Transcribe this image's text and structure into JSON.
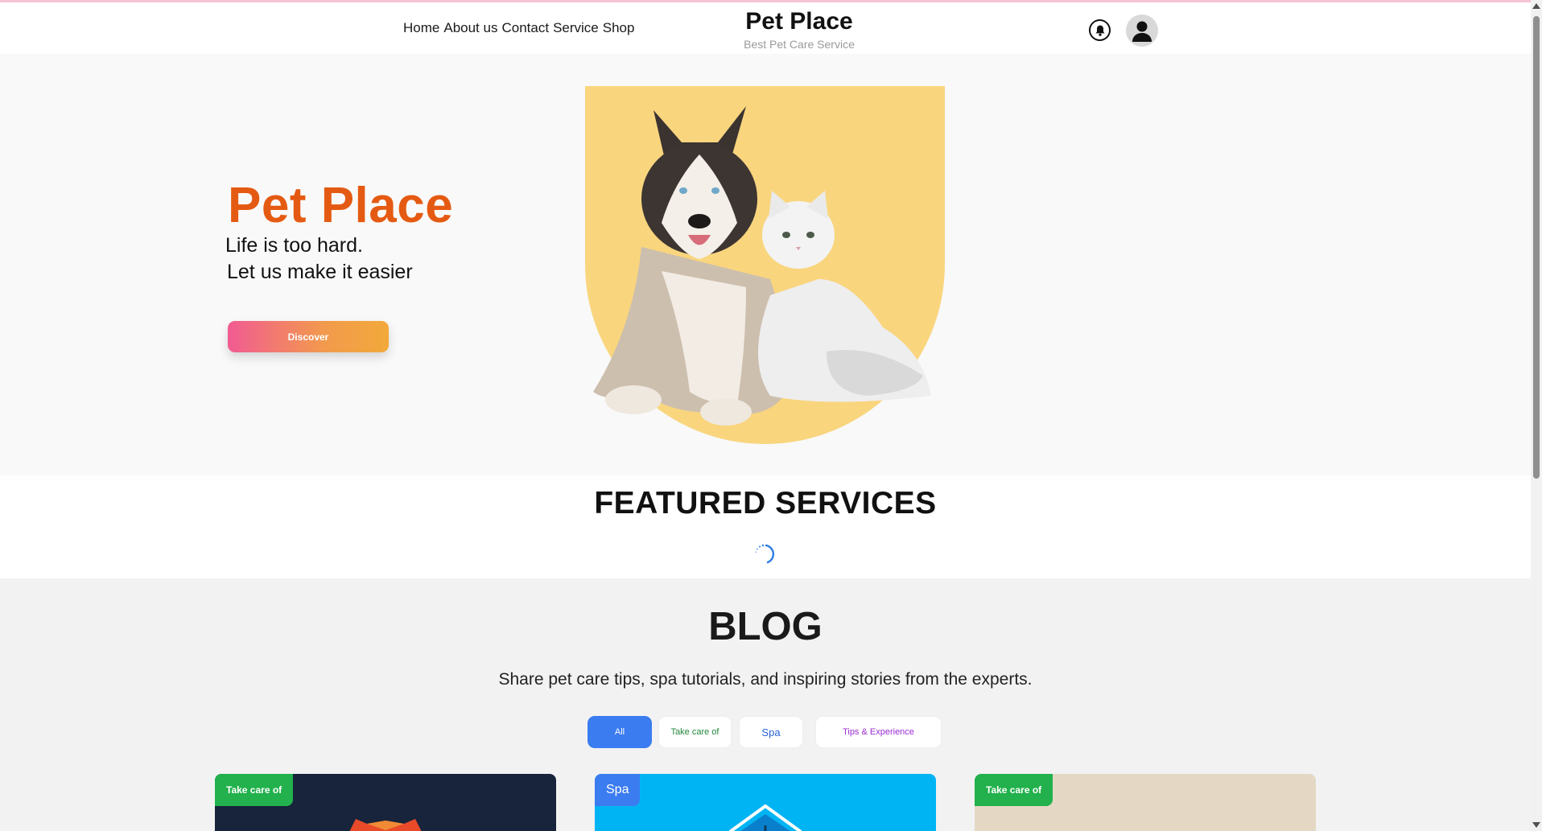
{
  "header": {
    "nav": [
      "Home",
      "About us",
      "Contact",
      "Service",
      "Shop"
    ],
    "brand_title": "Pet Place",
    "brand_subtitle": "Best Pet Care Service",
    "icons": {
      "notifications": "bell-icon",
      "account": "user-icon"
    }
  },
  "hero": {
    "title": "Pet Place",
    "line1": "Life is too hard.",
    "line2": "Let us make it easier",
    "cta": "Discover",
    "image": "dog-and-cat-illustration"
  },
  "featured": {
    "title": "FEATURED SERVICES",
    "loading_icon": "spinner-icon"
  },
  "blog": {
    "title": "BLOG",
    "subtitle": "Share pet care tips, spa tutorials, and inspiring stories from the experts.",
    "filters": [
      "All",
      "Take care of",
      "Spa",
      "Tips & Experience"
    ],
    "active_filter": "All",
    "cards": [
      {
        "tag": "Take care of"
      },
      {
        "tag": "Spa"
      },
      {
        "tag": "Take care of"
      }
    ]
  },
  "colors": {
    "accent_orange": "#e55a12",
    "filter_active": "#3b7cf0",
    "tag_green": "#22b14c",
    "hero_blob": "#f9d57e"
  }
}
